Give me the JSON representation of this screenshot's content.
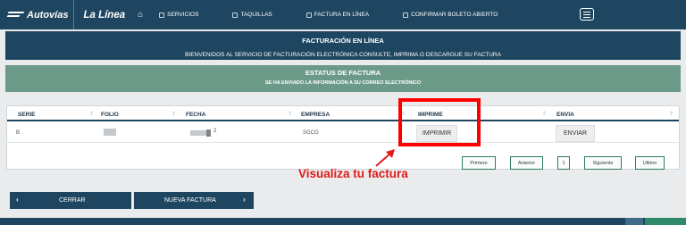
{
  "nav": {
    "brand": "Autovías",
    "brand_sub": "La Línea",
    "items": [
      {
        "label": "SERVICIOS",
        "icon": "calendar-icon"
      },
      {
        "label": "TAQUILLAS",
        "icon": "ticket-icon"
      },
      {
        "label": "FACTURA EN LÍNEA",
        "icon": "document-icon"
      },
      {
        "label": "CONFIRMAR BOLETO ABIERTO",
        "icon": "check-icon"
      }
    ],
    "home_icon": "home-icon",
    "menu_icon": "menu-icon"
  },
  "banner": {
    "title": "FACTURACIÓN EN LÍNEA",
    "subtitle": "BIENVENIDOS AL SERVICIO DE FACTURACIÓN ELECTRÓNICA CONSULTE, IMPRIMA O DESCARGUE SU FACTURA"
  },
  "status": {
    "title": "ESTATUS DE FACTURA",
    "message": "SE HA ENVIADO LA INFORMACIÓN A SU CORREO ELECTRÓNICO"
  },
  "table": {
    "headers": [
      "SERIE",
      "FOLIO",
      "FECHA",
      "EMPRESA",
      "IMPRIME",
      "ENVIA"
    ],
    "rows": [
      {
        "serie": "B",
        "fecha_tail": "2",
        "empresa": "SGCO",
        "imprime": "IMPRIMIR",
        "envia": "ENVIAR"
      }
    ]
  },
  "pagination": {
    "first": "Primero",
    "prev": "Anterior",
    "page": "1",
    "next": "Siguiente",
    "last": "Ultimo"
  },
  "annotation": "Visualiza tu factura",
  "actions": {
    "close": "CERRAR",
    "new_invoice": "NUEVA FACTURA"
  },
  "colors": {
    "navy": "#1e4660",
    "green": "#6c9a89",
    "highlight": "#ff0000"
  }
}
